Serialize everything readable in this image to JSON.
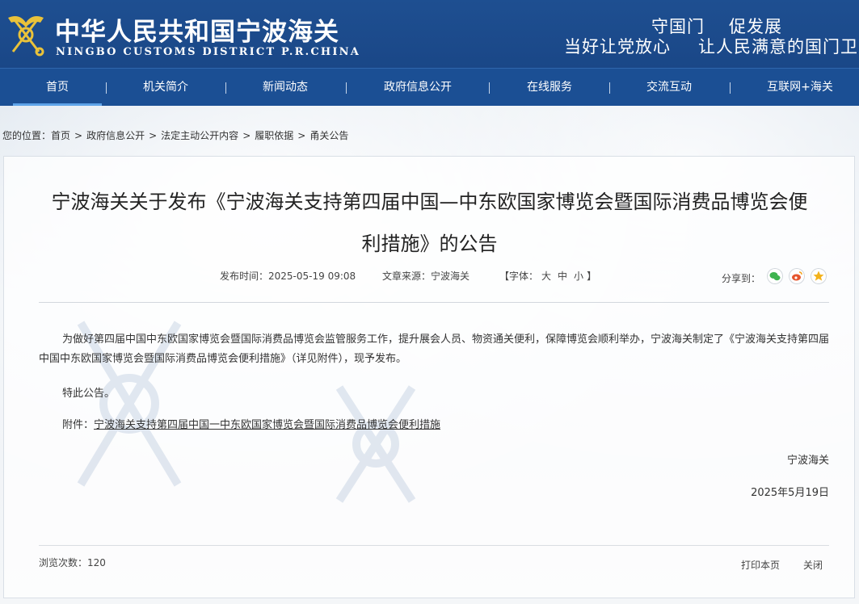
{
  "header": {
    "title": "中华人民共和国宁波海关",
    "subtitle": "NINGBO CUSTOMS DISTRICT P.R.CHINA",
    "slogan_line1": [
      "守国门",
      "促发展"
    ],
    "slogan_line2": [
      "当好让党放心",
      "让人民满意的国门卫士"
    ]
  },
  "nav": {
    "items": [
      "首页",
      "机关简介",
      "新闻动态",
      "政府信息公开",
      "在线服务",
      "交流互动",
      "互联网+海关"
    ],
    "active": "首页"
  },
  "breadcrumb": {
    "prefix": "您的位置：",
    "items": [
      "首页",
      "政府信息公开",
      "法定主动公开内容",
      "履职依据",
      "甬关公告"
    ],
    "separator": ">"
  },
  "article": {
    "title_line1": "宁波海关关于发布《宁波海关支持第四届中国—中东欧国家博览会暨国际消费品博览会便",
    "title_line2": "利措施》的公告",
    "publish_label": "发布时间：",
    "publish_time": "2025-05-19 09:08",
    "source_label": "文章来源：",
    "source": "宁波海关",
    "font_label_open": "【字体：",
    "font_large": "大",
    "font_medium": "中",
    "font_small": "小",
    "font_label_close": "】",
    "share_label": "分享到：",
    "paragraph1": "为做好第四届中国中东欧国家博览会暨国际消费品博览会监管服务工作，提升展会人员、物资通关便利，保障博览会顺利举办，宁波海关制定了《宁波海关支持第四届中国中东欧国家博览会暨国际消费品博览会便利措施》（详见附件），现予发布。",
    "paragraph2": "特此公告。",
    "attachment_label": "附件：",
    "attachment_link": "宁波海关支持第四届中国一中东欧国家博览会暨国际消费品博览会便利措施",
    "signature": "宁波海关",
    "date": "2025年5月19日"
  },
  "footer": {
    "views_label": "浏览次数：",
    "views_count": "120",
    "print_label": "打印本页",
    "close_label": "关闭"
  },
  "colors": {
    "header_bg": "#1e4f91",
    "nav_bg": "#1b4f94",
    "nav_active_underline": "#5ea3e8",
    "wechat": "#3fb34f",
    "weibo": "#e6552d",
    "qzone": "#f3b21b"
  },
  "icons": {
    "logo": "customs-emblem-icon",
    "share": [
      "wechat-icon",
      "weibo-icon",
      "qzone-icon"
    ]
  }
}
